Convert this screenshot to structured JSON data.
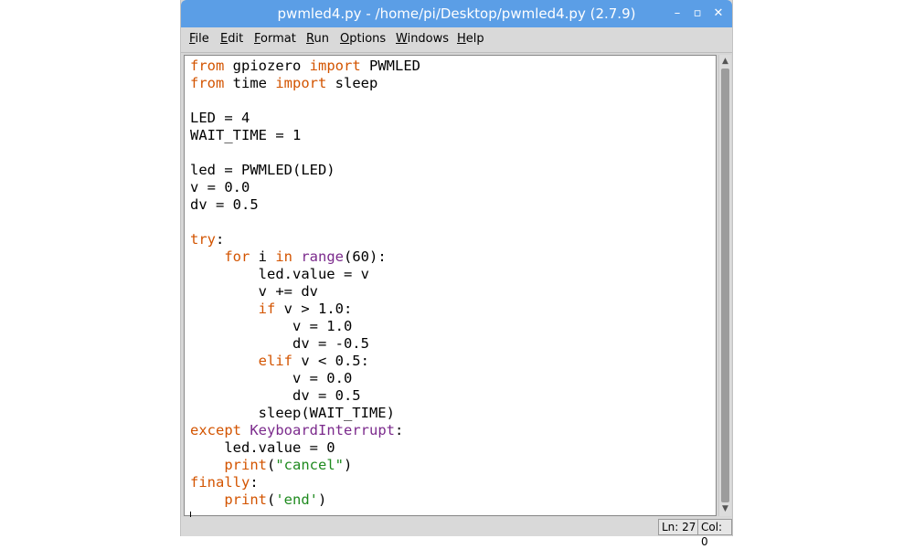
{
  "window": {
    "title": "pwmled4.py - /home/pi/Desktop/pwmled4.py (2.7.9)",
    "controls": {
      "minimize": "–",
      "maximize": "▫",
      "close": "✕"
    }
  },
  "menubar": {
    "items": [
      {
        "label_u": "F",
        "label_rest": "ile"
      },
      {
        "label_u": "E",
        "label_rest": "dit"
      },
      {
        "label_u": "F",
        "label_rest": "ormat"
      },
      {
        "label_u": "R",
        "label_rest": "un"
      },
      {
        "label_u": "O",
        "label_rest": "ptions"
      },
      {
        "label_u": "W",
        "label_rest": "indows"
      },
      {
        "label_u": "H",
        "label_rest": "elp"
      }
    ]
  },
  "editor": {
    "lines": [
      [
        {
          "t": "from",
          "c": "kw"
        },
        {
          "t": " gpiozero "
        },
        {
          "t": "import",
          "c": "kw"
        },
        {
          "t": " PWMLED"
        }
      ],
      [
        {
          "t": "from",
          "c": "kw"
        },
        {
          "t": " time "
        },
        {
          "t": "import",
          "c": "kw"
        },
        {
          "t": " sleep"
        }
      ],
      [],
      [
        {
          "t": "LED = 4"
        }
      ],
      [
        {
          "t": "WAIT_TIME = 1"
        }
      ],
      [],
      [
        {
          "t": "led = PWMLED(LED)"
        }
      ],
      [
        {
          "t": "v = 0.0"
        }
      ],
      [
        {
          "t": "dv = 0.5"
        }
      ],
      [],
      [
        {
          "t": "try",
          "c": "kw"
        },
        {
          "t": ":"
        }
      ],
      [
        {
          "t": "    "
        },
        {
          "t": "for",
          "c": "kw"
        },
        {
          "t": " i "
        },
        {
          "t": "in",
          "c": "kw"
        },
        {
          "t": " "
        },
        {
          "t": "range",
          "c": "bi"
        },
        {
          "t": "(60):"
        }
      ],
      [
        {
          "t": "        led.value = v"
        }
      ],
      [
        {
          "t": "        v += dv"
        }
      ],
      [
        {
          "t": "        "
        },
        {
          "t": "if",
          "c": "kw"
        },
        {
          "t": " v > 1.0:"
        }
      ],
      [
        {
          "t": "            v = 1.0"
        }
      ],
      [
        {
          "t": "            dv = -0.5"
        }
      ],
      [
        {
          "t": "        "
        },
        {
          "t": "elif",
          "c": "kw"
        },
        {
          "t": " v < 0.5:"
        }
      ],
      [
        {
          "t": "            v = 0.0"
        }
      ],
      [
        {
          "t": "            dv = 0.5"
        }
      ],
      [
        {
          "t": "        sleep(WAIT_TIME)"
        }
      ],
      [
        {
          "t": "except",
          "c": "kw"
        },
        {
          "t": " "
        },
        {
          "t": "KeyboardInterrupt",
          "c": "bi"
        },
        {
          "t": ":"
        }
      ],
      [
        {
          "t": "    led.value = 0"
        }
      ],
      [
        {
          "t": "    "
        },
        {
          "t": "print",
          "c": "kw"
        },
        {
          "t": "("
        },
        {
          "t": "\"cancel\"",
          "c": "str"
        },
        {
          "t": ")"
        }
      ],
      [
        {
          "t": "finally",
          "c": "kw"
        },
        {
          "t": ":"
        }
      ],
      [
        {
          "t": "    "
        },
        {
          "t": "print",
          "c": "kw"
        },
        {
          "t": "("
        },
        {
          "t": "'end'",
          "c": "str"
        },
        {
          "t": ")"
        }
      ],
      [
        {
          "cursor": true
        }
      ]
    ]
  },
  "statusbar": {
    "line": "Ln: 27",
    "col": "Col: 0"
  },
  "icons": {
    "scroll_up": "up-arrow",
    "scroll_down": "down-arrow"
  }
}
